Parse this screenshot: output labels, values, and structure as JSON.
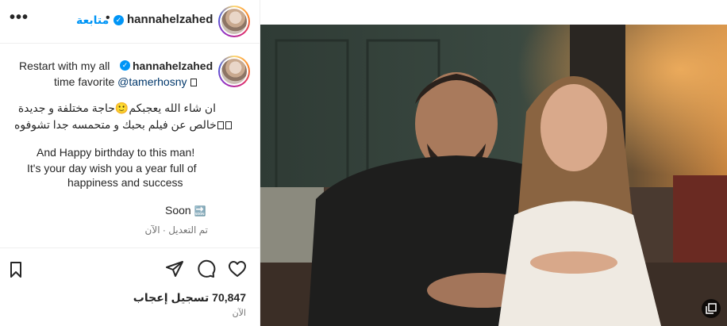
{
  "header": {
    "username": "hannahelzahed",
    "separator": "•",
    "follow_label": "متابعة",
    "more_label": "•••"
  },
  "caption": {
    "username": "hannahelzahed",
    "line1": "Restart with my all",
    "line2_text": "time favorite",
    "mention": "@tamerhosny",
    "arabic_line1": "ان شاء الله يعجبكم🙂حاجة مختلفة و جديدة",
    "arabic_line2": "خالص عن فيلم بحبك و متحمسه جدا تشوفوه",
    "english_para": [
      "And Happy birthday to this man!",
      "It's your day wish you a year full of",
      "happiness and success"
    ],
    "soon": "Soon",
    "soon_emoji": "🔜",
    "edited": "تم التعديل · الآن"
  },
  "engagement": {
    "likes_count": "70,847",
    "likes_label": "تسجيل إعجاب",
    "timestamp": "الآن"
  },
  "icons": [
    "more-icon",
    "verified-badge-icon",
    "heart-icon",
    "comment-icon",
    "share-icon",
    "bookmark-icon",
    "gallery-icon"
  ],
  "colors": {
    "accent": "#0095f6",
    "link": "#00376b",
    "text": "#262626",
    "muted": "#737373"
  }
}
